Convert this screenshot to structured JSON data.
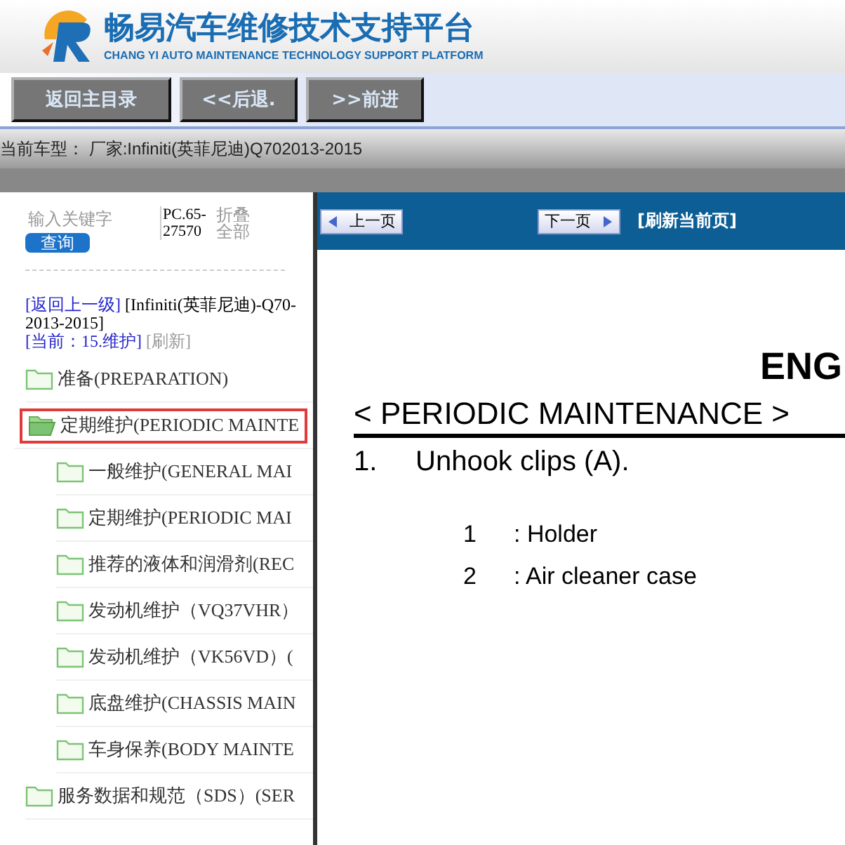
{
  "header": {
    "title": "畅易汽车维修技术支持平台",
    "subtitle": "CHANG YI AUTO MAINTENANCE TECHNOLOGY SUPPORT PLATFORM"
  },
  "toolbar": [
    "返回主目录",
    "<<后退.",
    ">>前进"
  ],
  "car_model": "当前车型： 厂家:Infiniti(英菲尼迪)Q702013-2015",
  "sidebar": {
    "search": {
      "placeholder": "输入关键字",
      "button": "查询"
    },
    "code": "PC.65-27570",
    "collapse": "折叠全部",
    "breadcrumb": {
      "back": "[返回上一级]",
      "path": "[Infiniti(英菲尼迪)-Q70-2013-2015]",
      "current": "[当前：15.维护]",
      "refresh": "[刷新]"
    },
    "tree": [
      {
        "label": "准备(PREPARATION)",
        "expanded": false,
        "selected": false
      },
      {
        "label": "定期维护(PERIODIC MAINTE",
        "expanded": true,
        "selected": true,
        "children": [
          {
            "label": "一般维护(GENERAL MAI",
            "expanded": false,
            "selected": false
          },
          {
            "label": "定期维护(PERIODIC MAI",
            "expanded": false,
            "selected": false
          },
          {
            "label": "推荐的液体和润滑剂(REC",
            "expanded": false,
            "selected": false
          },
          {
            "label": "发动机维护（VQ37VHR）",
            "expanded": false,
            "selected": false
          },
          {
            "label": "发动机维护（VK56VD）(",
            "expanded": false,
            "selected": false
          },
          {
            "label": "底盘维护(CHASSIS MAIN",
            "expanded": false,
            "selected": false
          },
          {
            "label": "车身保养(BODY MAINTE",
            "expanded": false,
            "selected": false
          }
        ]
      },
      {
        "label": "服务数据和规范（SDS）(SER",
        "expanded": false,
        "selected": false
      }
    ]
  },
  "pager": {
    "prev": "上一页",
    "next": "下一页",
    "refresh": "[刷新当前页]"
  },
  "document": {
    "heading": "ENG",
    "section": "< PERIODIC MAINTENANCE >",
    "step_number": "1.",
    "step_text": "Unhook clips (A).",
    "legend": [
      {
        "number": "1",
        "text": ": Holder"
      },
      {
        "number": "2",
        "text": ": Air cleaner case"
      }
    ]
  }
}
